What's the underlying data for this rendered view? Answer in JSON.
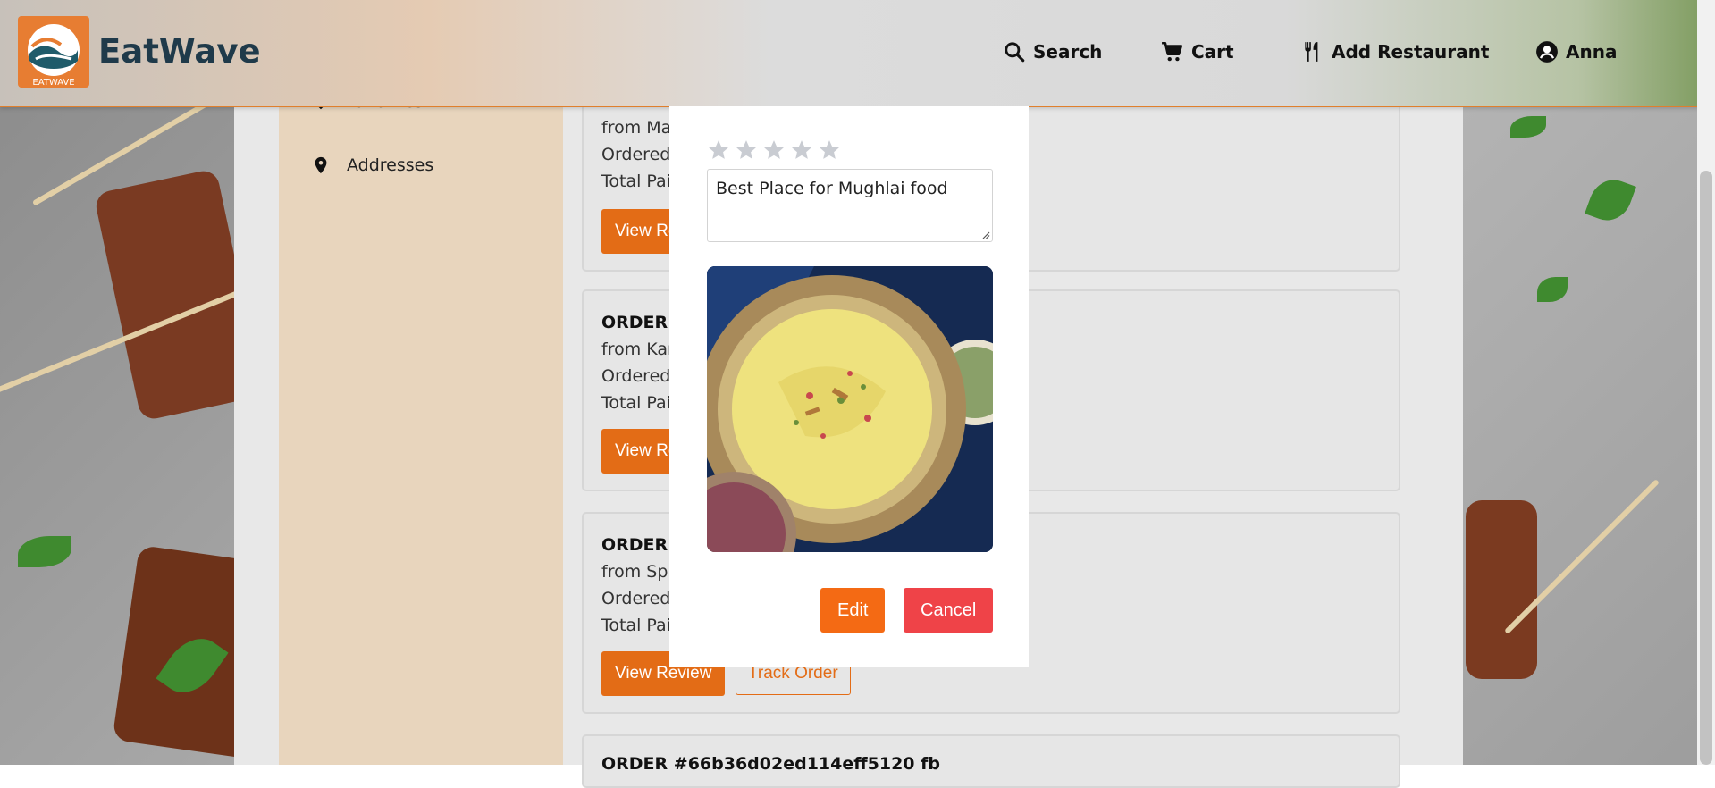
{
  "app": {
    "brand": "EatWave",
    "logo_text": "EATWAVE"
  },
  "nav": {
    "search": "Search",
    "cart": "Cart",
    "add_restaurant": "Add Restaurant",
    "user": "Anna"
  },
  "sidebar": {
    "items": [
      {
        "label": "Favorites",
        "icon": "heart-icon"
      },
      {
        "label": "Addresses",
        "icon": "location-pin-icon"
      }
    ]
  },
  "orders": [
    {
      "title": "",
      "from": "from Mar",
      "ordered": "Ordered",
      "total": "Total Paic",
      "view_label": "View Re",
      "track_label": ""
    },
    {
      "title": "ORDER #",
      "from": "from Kari",
      "ordered": "Ordered",
      "total": "Total Paic",
      "view_label": "View Re",
      "track_label": ""
    },
    {
      "title": "ORDER #",
      "from": "from Spic",
      "ordered": "Ordered",
      "total": "Total Paic",
      "view_label": "View Review",
      "track_label": "Track Order"
    },
    {
      "title": "ORDER #66b36d02ed114eff5120 fb",
      "from": "",
      "ordered": "",
      "total": "",
      "view_label": "",
      "track_label": ""
    }
  ],
  "modal": {
    "rating": 0,
    "rating_max": 5,
    "review_text": "Best Place for Mughlai food",
    "photo_alt": "dish photo",
    "edit_label": "Edit",
    "cancel_label": "Cancel"
  },
  "colors": {
    "accent": "#e36c16",
    "edit": "#f46a14",
    "cancel": "#ef4348",
    "sidebar": "#e8d5bd"
  }
}
